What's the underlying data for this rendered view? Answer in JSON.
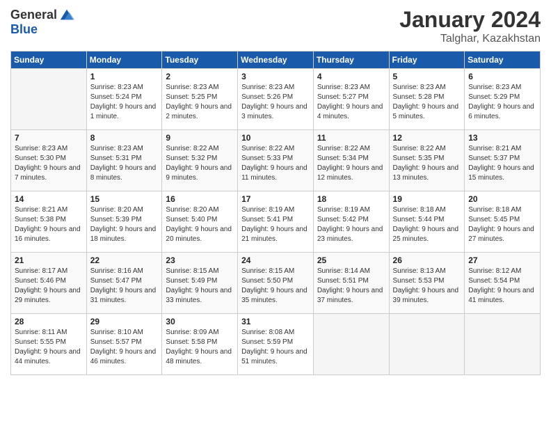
{
  "logo": {
    "general": "General",
    "blue": "Blue"
  },
  "title": "January 2024",
  "subtitle": "Talghar, Kazakhstan",
  "days_header": [
    "Sunday",
    "Monday",
    "Tuesday",
    "Wednesday",
    "Thursday",
    "Friday",
    "Saturday"
  ],
  "weeks": [
    [
      {
        "day": "",
        "sunrise": "",
        "sunset": "",
        "daylight": "",
        "empty": true
      },
      {
        "day": "1",
        "sunrise": "Sunrise: 8:23 AM",
        "sunset": "Sunset: 5:24 PM",
        "daylight": "Daylight: 9 hours and 1 minute."
      },
      {
        "day": "2",
        "sunrise": "Sunrise: 8:23 AM",
        "sunset": "Sunset: 5:25 PM",
        "daylight": "Daylight: 9 hours and 2 minutes."
      },
      {
        "day": "3",
        "sunrise": "Sunrise: 8:23 AM",
        "sunset": "Sunset: 5:26 PM",
        "daylight": "Daylight: 9 hours and 3 minutes."
      },
      {
        "day": "4",
        "sunrise": "Sunrise: 8:23 AM",
        "sunset": "Sunset: 5:27 PM",
        "daylight": "Daylight: 9 hours and 4 minutes."
      },
      {
        "day": "5",
        "sunrise": "Sunrise: 8:23 AM",
        "sunset": "Sunset: 5:28 PM",
        "daylight": "Daylight: 9 hours and 5 minutes."
      },
      {
        "day": "6",
        "sunrise": "Sunrise: 8:23 AM",
        "sunset": "Sunset: 5:29 PM",
        "daylight": "Daylight: 9 hours and 6 minutes."
      }
    ],
    [
      {
        "day": "7",
        "sunrise": "Sunrise: 8:23 AM",
        "sunset": "Sunset: 5:30 PM",
        "daylight": "Daylight: 9 hours and 7 minutes."
      },
      {
        "day": "8",
        "sunrise": "Sunrise: 8:23 AM",
        "sunset": "Sunset: 5:31 PM",
        "daylight": "Daylight: 9 hours and 8 minutes."
      },
      {
        "day": "9",
        "sunrise": "Sunrise: 8:22 AM",
        "sunset": "Sunset: 5:32 PM",
        "daylight": "Daylight: 9 hours and 9 minutes."
      },
      {
        "day": "10",
        "sunrise": "Sunrise: 8:22 AM",
        "sunset": "Sunset: 5:33 PM",
        "daylight": "Daylight: 9 hours and 11 minutes."
      },
      {
        "day": "11",
        "sunrise": "Sunrise: 8:22 AM",
        "sunset": "Sunset: 5:34 PM",
        "daylight": "Daylight: 9 hours and 12 minutes."
      },
      {
        "day": "12",
        "sunrise": "Sunrise: 8:22 AM",
        "sunset": "Sunset: 5:35 PM",
        "daylight": "Daylight: 9 hours and 13 minutes."
      },
      {
        "day": "13",
        "sunrise": "Sunrise: 8:21 AM",
        "sunset": "Sunset: 5:37 PM",
        "daylight": "Daylight: 9 hours and 15 minutes."
      }
    ],
    [
      {
        "day": "14",
        "sunrise": "Sunrise: 8:21 AM",
        "sunset": "Sunset: 5:38 PM",
        "daylight": "Daylight: 9 hours and 16 minutes."
      },
      {
        "day": "15",
        "sunrise": "Sunrise: 8:20 AM",
        "sunset": "Sunset: 5:39 PM",
        "daylight": "Daylight: 9 hours and 18 minutes."
      },
      {
        "day": "16",
        "sunrise": "Sunrise: 8:20 AM",
        "sunset": "Sunset: 5:40 PM",
        "daylight": "Daylight: 9 hours and 20 minutes."
      },
      {
        "day": "17",
        "sunrise": "Sunrise: 8:19 AM",
        "sunset": "Sunset: 5:41 PM",
        "daylight": "Daylight: 9 hours and 21 minutes."
      },
      {
        "day": "18",
        "sunrise": "Sunrise: 8:19 AM",
        "sunset": "Sunset: 5:42 PM",
        "daylight": "Daylight: 9 hours and 23 minutes."
      },
      {
        "day": "19",
        "sunrise": "Sunrise: 8:18 AM",
        "sunset": "Sunset: 5:44 PM",
        "daylight": "Daylight: 9 hours and 25 minutes."
      },
      {
        "day": "20",
        "sunrise": "Sunrise: 8:18 AM",
        "sunset": "Sunset: 5:45 PM",
        "daylight": "Daylight: 9 hours and 27 minutes."
      }
    ],
    [
      {
        "day": "21",
        "sunrise": "Sunrise: 8:17 AM",
        "sunset": "Sunset: 5:46 PM",
        "daylight": "Daylight: 9 hours and 29 minutes."
      },
      {
        "day": "22",
        "sunrise": "Sunrise: 8:16 AM",
        "sunset": "Sunset: 5:47 PM",
        "daylight": "Daylight: 9 hours and 31 minutes."
      },
      {
        "day": "23",
        "sunrise": "Sunrise: 8:15 AM",
        "sunset": "Sunset: 5:49 PM",
        "daylight": "Daylight: 9 hours and 33 minutes."
      },
      {
        "day": "24",
        "sunrise": "Sunrise: 8:15 AM",
        "sunset": "Sunset: 5:50 PM",
        "daylight": "Daylight: 9 hours and 35 minutes."
      },
      {
        "day": "25",
        "sunrise": "Sunrise: 8:14 AM",
        "sunset": "Sunset: 5:51 PM",
        "daylight": "Daylight: 9 hours and 37 minutes."
      },
      {
        "day": "26",
        "sunrise": "Sunrise: 8:13 AM",
        "sunset": "Sunset: 5:53 PM",
        "daylight": "Daylight: 9 hours and 39 minutes."
      },
      {
        "day": "27",
        "sunrise": "Sunrise: 8:12 AM",
        "sunset": "Sunset: 5:54 PM",
        "daylight": "Daylight: 9 hours and 41 minutes."
      }
    ],
    [
      {
        "day": "28",
        "sunrise": "Sunrise: 8:11 AM",
        "sunset": "Sunset: 5:55 PM",
        "daylight": "Daylight: 9 hours and 44 minutes."
      },
      {
        "day": "29",
        "sunrise": "Sunrise: 8:10 AM",
        "sunset": "Sunset: 5:57 PM",
        "daylight": "Daylight: 9 hours and 46 minutes."
      },
      {
        "day": "30",
        "sunrise": "Sunrise: 8:09 AM",
        "sunset": "Sunset: 5:58 PM",
        "daylight": "Daylight: 9 hours and 48 minutes."
      },
      {
        "day": "31",
        "sunrise": "Sunrise: 8:08 AM",
        "sunset": "Sunset: 5:59 PM",
        "daylight": "Daylight: 9 hours and 51 minutes."
      },
      {
        "day": "",
        "sunrise": "",
        "sunset": "",
        "daylight": "",
        "empty": true
      },
      {
        "day": "",
        "sunrise": "",
        "sunset": "",
        "daylight": "",
        "empty": true
      },
      {
        "day": "",
        "sunrise": "",
        "sunset": "",
        "daylight": "",
        "empty": true
      }
    ]
  ]
}
